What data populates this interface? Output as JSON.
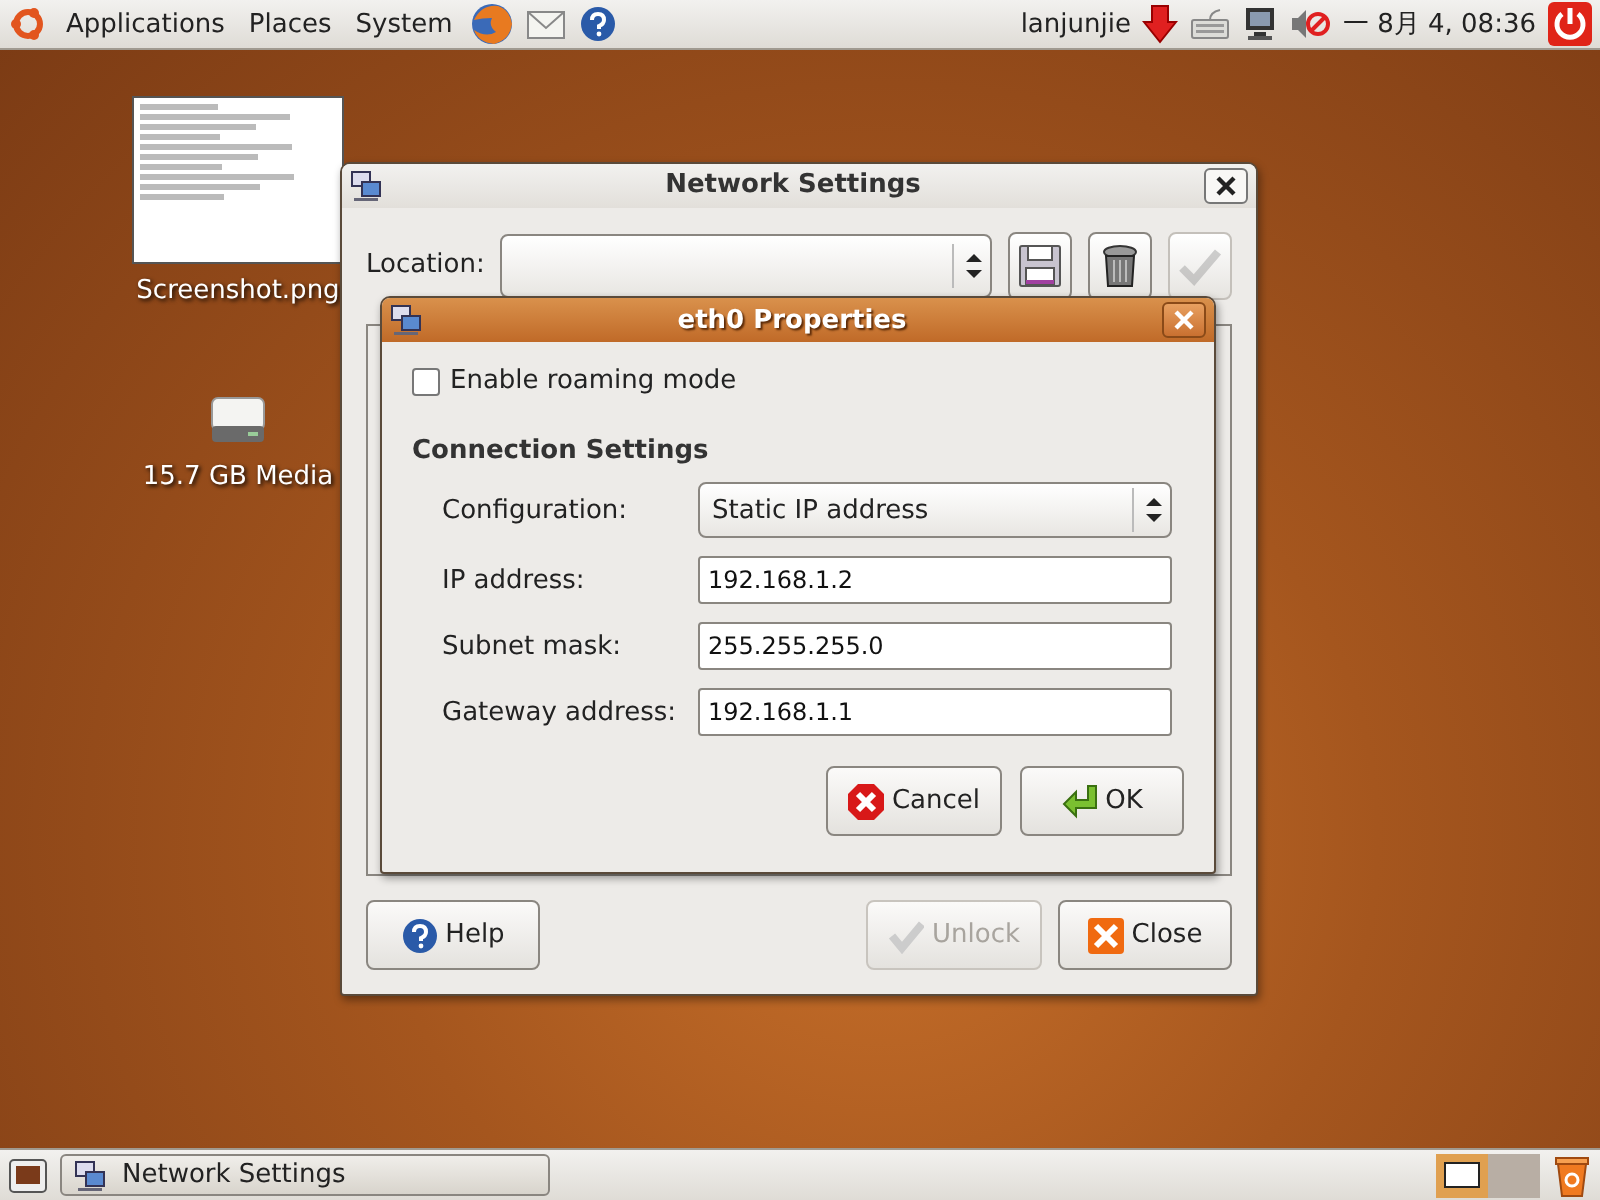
{
  "top_panel": {
    "menus": [
      "Applications",
      "Places",
      "System"
    ],
    "user": "lanjunjie",
    "clock": "一 8月 4, 08:36"
  },
  "desktop_icons": [
    {
      "label": "Screenshot.png",
      "kind": "screenshot"
    },
    {
      "label": "15.7 GB Media",
      "kind": "drive"
    }
  ],
  "network_settings": {
    "title": "Network Settings",
    "active": false,
    "location_label": "Location:",
    "tools": [
      {
        "kind": "save",
        "disabled": false
      },
      {
        "kind": "delete",
        "disabled": false
      },
      {
        "kind": "apply",
        "disabled": true
      }
    ],
    "buttons": [
      {
        "label": "Help",
        "kind": "help",
        "disabled": false
      },
      {
        "label": "Unlock",
        "kind": "unlock",
        "disabled": true
      },
      {
        "label": "Close",
        "kind": "close",
        "disabled": false
      }
    ]
  },
  "properties_dialog": {
    "title": "eth0 Properties",
    "active": true,
    "roaming": {
      "label": "Enable roaming mode",
      "checked": false
    },
    "section": "Connection Settings",
    "configuration": {
      "label": "Configuration:",
      "value": "Static IP address"
    },
    "fields": [
      {
        "label": "IP address:",
        "value": "192.168.1.2"
      },
      {
        "label": "Subnet mask:",
        "value": "255.255.255.0"
      },
      {
        "label": "Gateway address:",
        "value": "192.168.1.1"
      }
    ],
    "buttons": [
      {
        "label": "Cancel",
        "kind": "cancel"
      },
      {
        "label": "OK",
        "kind": "ok"
      }
    ]
  },
  "taskbar": {
    "items": [
      {
        "label": "Network Settings"
      }
    ],
    "workspaces": [
      {
        "selected": true
      },
      {
        "selected": false
      }
    ]
  }
}
